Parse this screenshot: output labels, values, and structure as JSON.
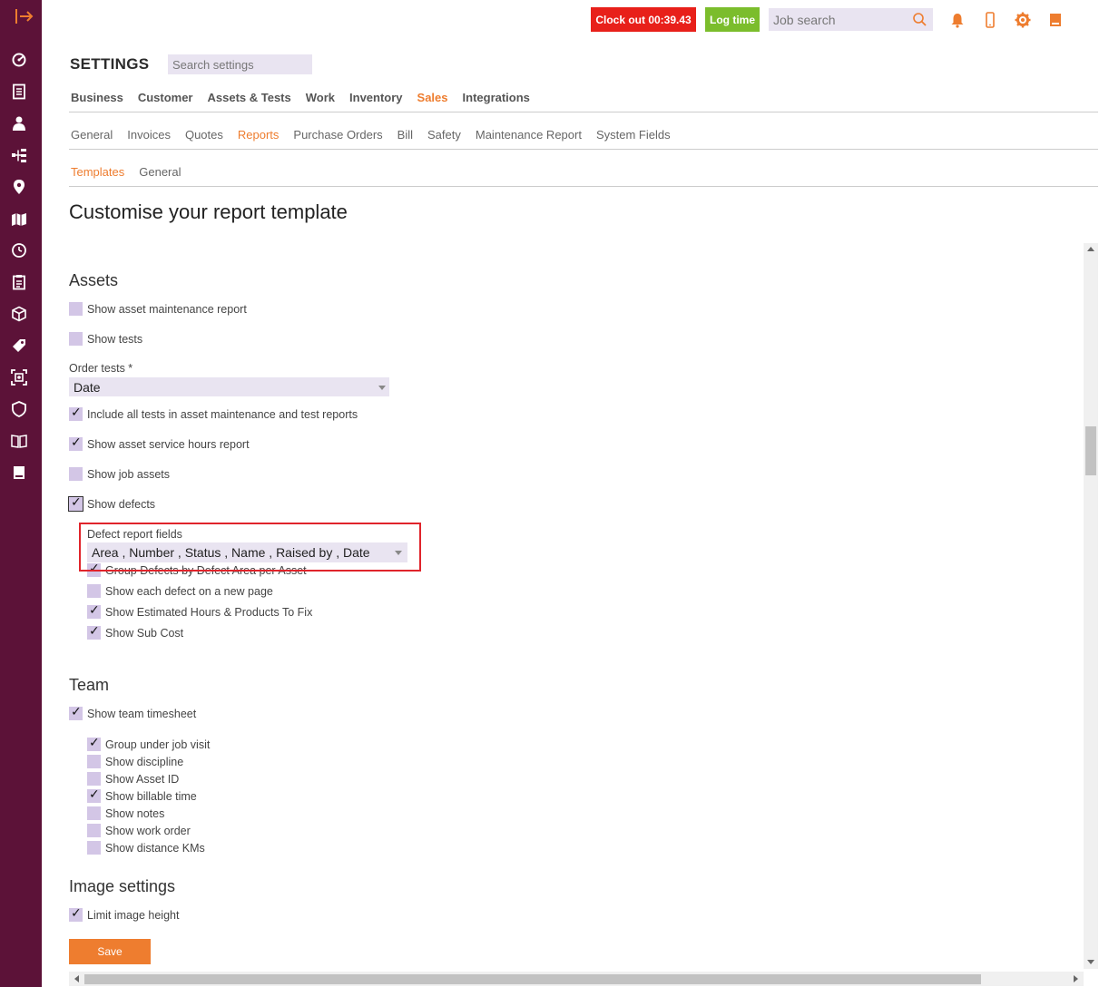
{
  "sidebar": {
    "icons": [
      "expand-icon",
      "dashboard-icon",
      "document-list-icon",
      "user-icon",
      "hierarchy-icon",
      "location-pin-icon",
      "map-icon",
      "clock-icon",
      "clipboard-icon",
      "cube-icon",
      "tag-icon",
      "scan-icon",
      "shield-icon",
      "book-open-icon",
      "book-icon"
    ]
  },
  "topbar": {
    "clock_out_label": "Clock out 00:39.43",
    "log_time_label": "Log time",
    "job_search_placeholder": "Job search"
  },
  "settings": {
    "title": "SETTINGS",
    "search_placeholder": "Search settings"
  },
  "tabs_primary": [
    "Business",
    "Customer",
    "Assets & Tests",
    "Work",
    "Inventory",
    "Sales",
    "Integrations"
  ],
  "tabs_primary_active": "Sales",
  "tabs_secondary": [
    "General",
    "Invoices",
    "Quotes",
    "Reports",
    "Purchase Orders",
    "Bill",
    "Safety",
    "Maintenance Report",
    "System Fields"
  ],
  "tabs_secondary_active": "Reports",
  "tabs_tertiary": [
    "Templates",
    "General"
  ],
  "tabs_tertiary_active": "Templates",
  "page_heading": "Customise your report template",
  "assets": {
    "heading": "Assets",
    "show_asset_maintenance_report": {
      "label": "Show asset maintenance report",
      "checked": false
    },
    "show_tests": {
      "label": "Show tests",
      "checked": false
    },
    "order_tests_label": "Order tests *",
    "order_tests_value": "Date",
    "include_all_tests": {
      "label": "Include all tests in asset maintenance and test reports",
      "checked": true
    },
    "show_service_hours": {
      "label": "Show asset service hours report",
      "checked": true
    },
    "show_job_assets": {
      "label": "Show job assets",
      "checked": false
    },
    "show_defects": {
      "label": "Show defects",
      "checked": true
    },
    "defect_fields_label": "Defect report fields",
    "defect_fields_value": "Area , Number , Status , Name , Raised by , Date",
    "group_defects": {
      "label": "Group Defects by Defect Area per Asset",
      "checked": true
    },
    "each_defect_new_page": {
      "label": "Show each defect on a new page",
      "checked": false
    },
    "estimated_hours": {
      "label": "Show Estimated Hours & Products To Fix",
      "checked": true
    },
    "sub_cost": {
      "label": "Show Sub Cost",
      "checked": true
    }
  },
  "team": {
    "heading": "Team",
    "show_team_timesheet": {
      "label": "Show team timesheet",
      "checked": true
    },
    "group_under_job_visit": {
      "label": "Group under job visit",
      "checked": true
    },
    "show_discipline": {
      "label": "Show discipline",
      "checked": false
    },
    "show_asset_id": {
      "label": "Show Asset ID",
      "checked": false
    },
    "show_billable_time": {
      "label": "Show billable time",
      "checked": true
    },
    "show_notes": {
      "label": "Show notes",
      "checked": false
    },
    "show_work_order": {
      "label": "Show work order",
      "checked": false
    },
    "show_distance": {
      "label": "Show distance KMs",
      "checked": false
    }
  },
  "image_settings": {
    "heading": "Image settings",
    "limit_image_height": {
      "label": "Limit image height",
      "checked": true
    }
  },
  "save_label": "Save",
  "colors": {
    "sidebar": "#5c1238",
    "accent": "#ee7d2f",
    "clock_out": "#e8201a",
    "log_time": "#7bbd2c",
    "checkbox": "#d3c6e6",
    "highlight_box": "#e0242b"
  }
}
